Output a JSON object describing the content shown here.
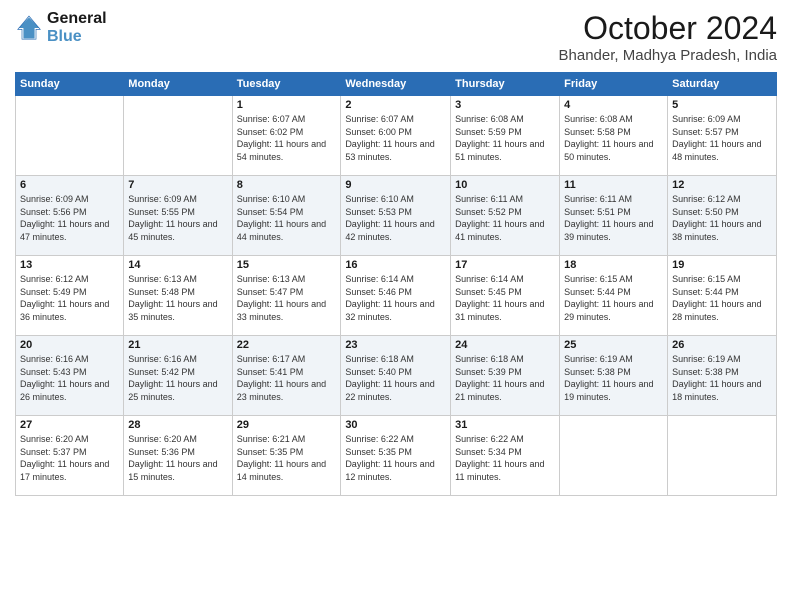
{
  "logo": {
    "line1": "General",
    "line2": "Blue"
  },
  "header": {
    "month": "October 2024",
    "location": "Bhander, Madhya Pradesh, India"
  },
  "weekdays": [
    "Sunday",
    "Monday",
    "Tuesday",
    "Wednesday",
    "Thursday",
    "Friday",
    "Saturday"
  ],
  "weeks": [
    [
      {
        "day": "",
        "info": ""
      },
      {
        "day": "",
        "info": ""
      },
      {
        "day": "1",
        "info": "Sunrise: 6:07 AM\nSunset: 6:02 PM\nDaylight: 11 hours and 54 minutes."
      },
      {
        "day": "2",
        "info": "Sunrise: 6:07 AM\nSunset: 6:00 PM\nDaylight: 11 hours and 53 minutes."
      },
      {
        "day": "3",
        "info": "Sunrise: 6:08 AM\nSunset: 5:59 PM\nDaylight: 11 hours and 51 minutes."
      },
      {
        "day": "4",
        "info": "Sunrise: 6:08 AM\nSunset: 5:58 PM\nDaylight: 11 hours and 50 minutes."
      },
      {
        "day": "5",
        "info": "Sunrise: 6:09 AM\nSunset: 5:57 PM\nDaylight: 11 hours and 48 minutes."
      }
    ],
    [
      {
        "day": "6",
        "info": "Sunrise: 6:09 AM\nSunset: 5:56 PM\nDaylight: 11 hours and 47 minutes."
      },
      {
        "day": "7",
        "info": "Sunrise: 6:09 AM\nSunset: 5:55 PM\nDaylight: 11 hours and 45 minutes."
      },
      {
        "day": "8",
        "info": "Sunrise: 6:10 AM\nSunset: 5:54 PM\nDaylight: 11 hours and 44 minutes."
      },
      {
        "day": "9",
        "info": "Sunrise: 6:10 AM\nSunset: 5:53 PM\nDaylight: 11 hours and 42 minutes."
      },
      {
        "day": "10",
        "info": "Sunrise: 6:11 AM\nSunset: 5:52 PM\nDaylight: 11 hours and 41 minutes."
      },
      {
        "day": "11",
        "info": "Sunrise: 6:11 AM\nSunset: 5:51 PM\nDaylight: 11 hours and 39 minutes."
      },
      {
        "day": "12",
        "info": "Sunrise: 6:12 AM\nSunset: 5:50 PM\nDaylight: 11 hours and 38 minutes."
      }
    ],
    [
      {
        "day": "13",
        "info": "Sunrise: 6:12 AM\nSunset: 5:49 PM\nDaylight: 11 hours and 36 minutes."
      },
      {
        "day": "14",
        "info": "Sunrise: 6:13 AM\nSunset: 5:48 PM\nDaylight: 11 hours and 35 minutes."
      },
      {
        "day": "15",
        "info": "Sunrise: 6:13 AM\nSunset: 5:47 PM\nDaylight: 11 hours and 33 minutes."
      },
      {
        "day": "16",
        "info": "Sunrise: 6:14 AM\nSunset: 5:46 PM\nDaylight: 11 hours and 32 minutes."
      },
      {
        "day": "17",
        "info": "Sunrise: 6:14 AM\nSunset: 5:45 PM\nDaylight: 11 hours and 31 minutes."
      },
      {
        "day": "18",
        "info": "Sunrise: 6:15 AM\nSunset: 5:44 PM\nDaylight: 11 hours and 29 minutes."
      },
      {
        "day": "19",
        "info": "Sunrise: 6:15 AM\nSunset: 5:44 PM\nDaylight: 11 hours and 28 minutes."
      }
    ],
    [
      {
        "day": "20",
        "info": "Sunrise: 6:16 AM\nSunset: 5:43 PM\nDaylight: 11 hours and 26 minutes."
      },
      {
        "day": "21",
        "info": "Sunrise: 6:16 AM\nSunset: 5:42 PM\nDaylight: 11 hours and 25 minutes."
      },
      {
        "day": "22",
        "info": "Sunrise: 6:17 AM\nSunset: 5:41 PM\nDaylight: 11 hours and 23 minutes."
      },
      {
        "day": "23",
        "info": "Sunrise: 6:18 AM\nSunset: 5:40 PM\nDaylight: 11 hours and 22 minutes."
      },
      {
        "day": "24",
        "info": "Sunrise: 6:18 AM\nSunset: 5:39 PM\nDaylight: 11 hours and 21 minutes."
      },
      {
        "day": "25",
        "info": "Sunrise: 6:19 AM\nSunset: 5:38 PM\nDaylight: 11 hours and 19 minutes."
      },
      {
        "day": "26",
        "info": "Sunrise: 6:19 AM\nSunset: 5:38 PM\nDaylight: 11 hours and 18 minutes."
      }
    ],
    [
      {
        "day": "27",
        "info": "Sunrise: 6:20 AM\nSunset: 5:37 PM\nDaylight: 11 hours and 17 minutes."
      },
      {
        "day": "28",
        "info": "Sunrise: 6:20 AM\nSunset: 5:36 PM\nDaylight: 11 hours and 15 minutes."
      },
      {
        "day": "29",
        "info": "Sunrise: 6:21 AM\nSunset: 5:35 PM\nDaylight: 11 hours and 14 minutes."
      },
      {
        "day": "30",
        "info": "Sunrise: 6:22 AM\nSunset: 5:35 PM\nDaylight: 11 hours and 12 minutes."
      },
      {
        "day": "31",
        "info": "Sunrise: 6:22 AM\nSunset: 5:34 PM\nDaylight: 11 hours and 11 minutes."
      },
      {
        "day": "",
        "info": ""
      },
      {
        "day": "",
        "info": ""
      }
    ]
  ]
}
